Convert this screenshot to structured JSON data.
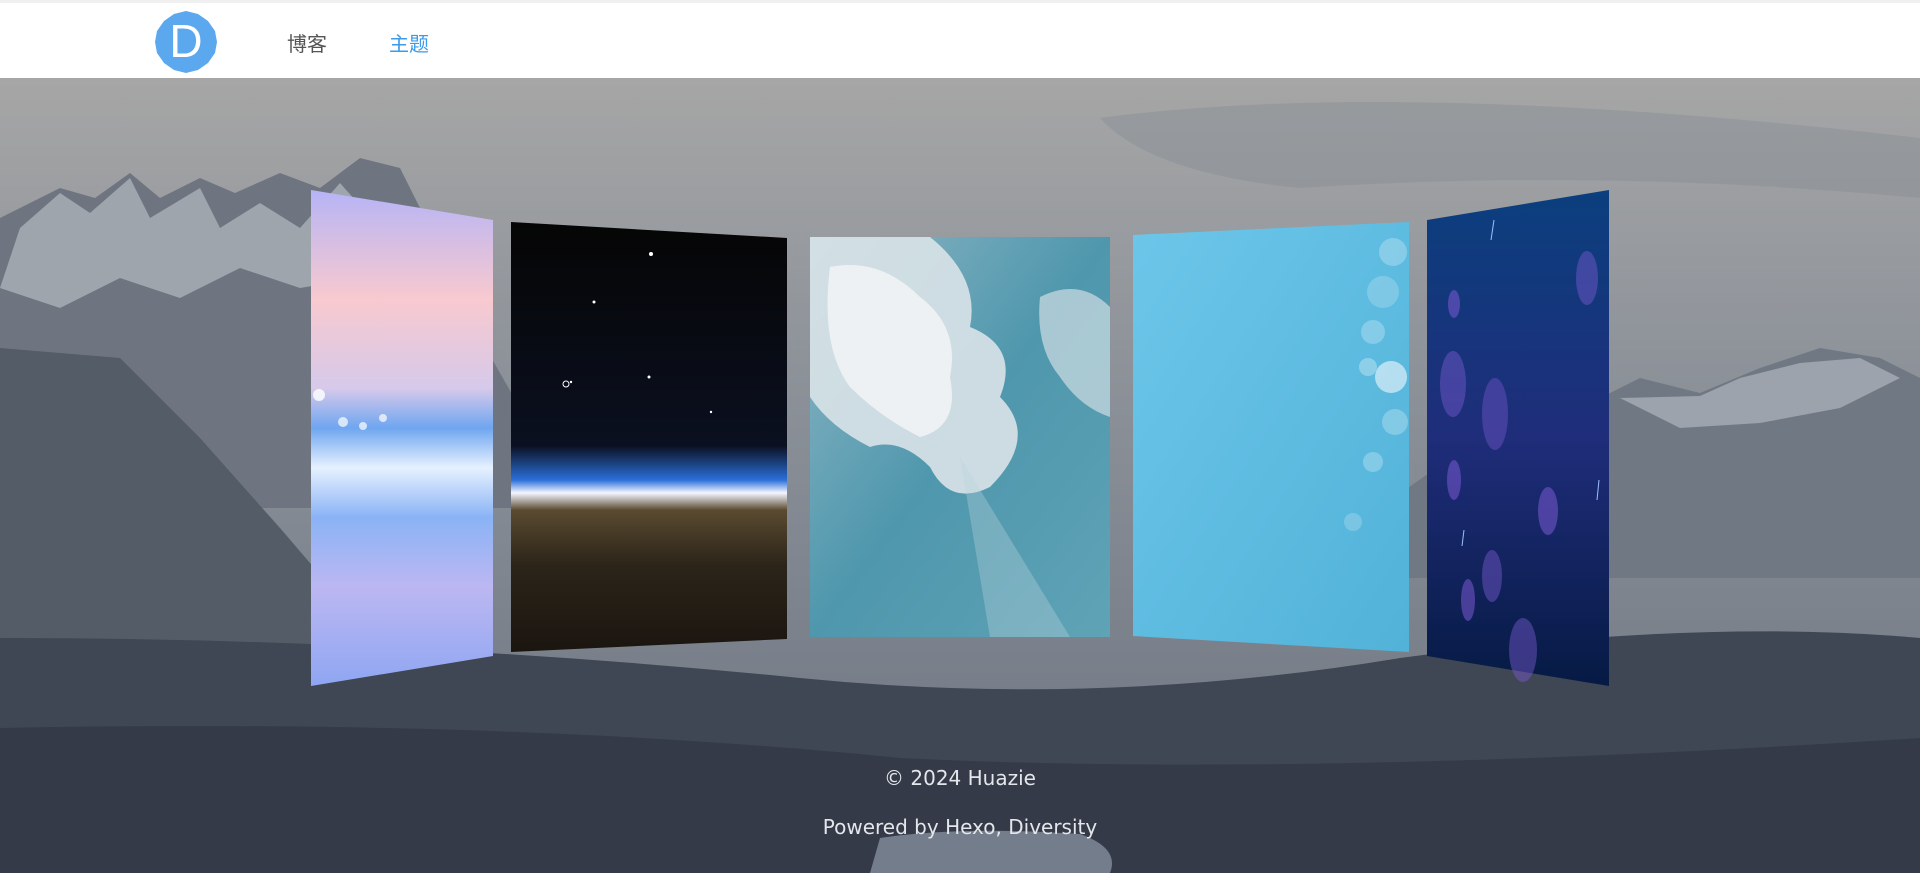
{
  "nav": {
    "logo_letter": "D",
    "items": [
      {
        "label": "博客",
        "active": false
      },
      {
        "label": "主题",
        "active": true
      }
    ],
    "active_color": "#3d9be9",
    "logo_color": "#5ba8ef"
  },
  "themes": [
    {
      "name": "sunset-sea"
    },
    {
      "name": "space-horizon"
    },
    {
      "name": "clouds"
    },
    {
      "name": "bokeh-blue"
    },
    {
      "name": "deep-blue-bubbles"
    }
  ],
  "footer": {
    "copyright": "© 2024 Huazie",
    "powered_prefix": "Powered by ",
    "hexo": "Hexo",
    "separator": ", ",
    "diversity": "Diversity"
  }
}
